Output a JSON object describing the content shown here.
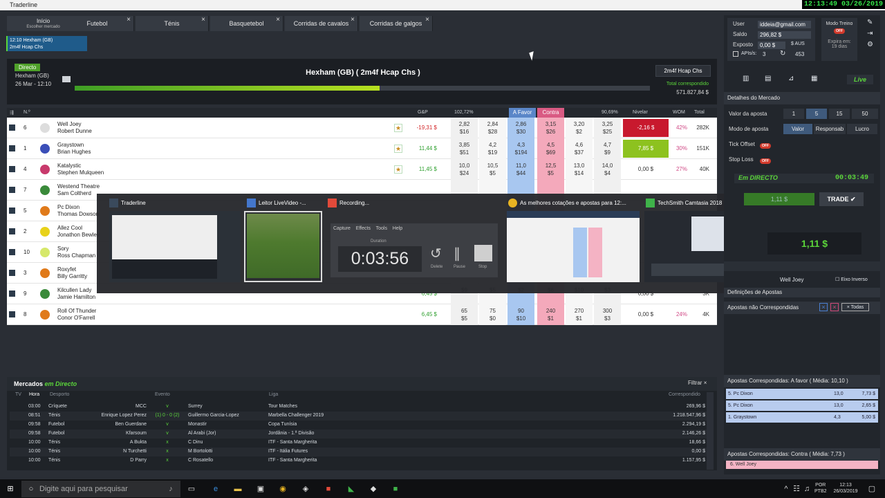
{
  "window": {
    "title": "Traderline",
    "clock": "12:13:49 03/26/2019"
  },
  "tabs": [
    {
      "label": "Início",
      "sub": "Escolher mercado"
    },
    {
      "label": "Futebol"
    },
    {
      "label": "Ténis"
    },
    {
      "label": "Basquetebol"
    },
    {
      "label": "Corridas de cavalos"
    },
    {
      "label": "Corridas de galgos"
    }
  ],
  "close_glyph": "×",
  "race_tab": {
    "line1": "12:10 Hexham (GB)",
    "line2": "2m4f Hcap Chs"
  },
  "race": {
    "badge": "Directo",
    "venue": "Hexham (GB)",
    "datetime": "26 Mar - 12:10",
    "title": "Hexham (GB) ( 2m4f Hcap Chs )",
    "market_button": "2m4f Hcap Chs",
    "matched_label": "Total correspondido",
    "matched_value": "571.827,84 $",
    "progress": 0.53
  },
  "grid": {
    "headers": {
      "n": "N.º",
      "gp": "G&P",
      "back_pct": "102,72%",
      "back": "A Favor",
      "lay": "Contra",
      "lay_pct": "90,69%",
      "nivelar": "Nivelar",
      "wom": "WOM",
      "total": "Total"
    },
    "runners": [
      {
        "num": "6",
        "horse": "Well Joey",
        "jockey": "Robert Dunne",
        "gp": "-19,31 $",
        "gp_color": "#d3282a",
        "back": [
          [
            "2,82",
            "$16"
          ],
          [
            "2,84",
            "$28"
          ],
          [
            "2,86",
            "$30"
          ]
        ],
        "lay": [
          [
            "3,15",
            "$26"
          ],
          [
            "3,20",
            "$2"
          ],
          [
            "3,25",
            "$25"
          ]
        ],
        "nivelar": "-2,16 $",
        "niv_bg": "#c8192e",
        "wom": "42%",
        "total": "282K",
        "silk": "#ddd"
      },
      {
        "num": "1",
        "horse": "Graystown",
        "jockey": "Brian Hughes",
        "gp": "11,44 $",
        "gp_color": "#2fa02f",
        "back": [
          [
            "3,85",
            "$51"
          ],
          [
            "4,2",
            "$19"
          ],
          [
            "4,3",
            "$194"
          ]
        ],
        "lay": [
          [
            "4,5",
            "$69"
          ],
          [
            "4,6",
            "$37"
          ],
          [
            "4,7",
            "$9"
          ]
        ],
        "nivelar": "7,85 $",
        "niv_bg": "#8dc21f",
        "wom": "30%",
        "total": "151K",
        "silk": "#3b4fb8"
      },
      {
        "num": "4",
        "horse": "Katalystic",
        "jockey": "Stephen Mulqueen",
        "gp": "11,45 $",
        "gp_color": "#2fa02f",
        "back": [
          [
            "10,0",
            "$24"
          ],
          [
            "10,5",
            "$5"
          ],
          [
            "11,0",
            "$44"
          ]
        ],
        "lay": [
          [
            "12,5",
            "$5"
          ],
          [
            "13,0",
            "$14"
          ],
          [
            "14,0",
            "$4"
          ]
        ],
        "nivelar": "0,00 $",
        "niv_bg": "",
        "wom": "27%",
        "total": "40K",
        "silk": "#c83a6c"
      },
      {
        "num": "7",
        "horse": "Westend Theatre",
        "jockey": "Sam Coltherd",
        "gp": "",
        "gp_color": "#2fa02f",
        "back": [
          [
            "",
            ""
          ],
          [
            "",
            ""
          ],
          [
            "",
            ""
          ]
        ],
        "lay": [
          [
            "",
            ""
          ],
          [
            "",
            ""
          ],
          [
            "",
            ""
          ]
        ],
        "nivelar": "",
        "niv_bg": "",
        "wom": "",
        "total": "",
        "silk": "#3a8a3a"
      },
      {
        "num": "5",
        "horse": "Pc Dixon",
        "jockey": "Thomas Dowson",
        "gp": "",
        "gp_color": "#2fa02f",
        "back": [
          [
            "",
            ""
          ],
          [
            "",
            ""
          ],
          [
            "",
            ""
          ]
        ],
        "lay": [
          [
            "",
            ""
          ],
          [
            "",
            ""
          ],
          [
            "",
            ""
          ]
        ],
        "nivelar": "",
        "niv_bg": "",
        "wom": "",
        "total": "",
        "silk": "#e07a1a"
      },
      {
        "num": "2",
        "horse": "Allez Cool",
        "jockey": "Jonathon Bewley",
        "gp": "",
        "gp_color": "#2fa02f",
        "back": [
          [
            "",
            ""
          ],
          [
            "",
            ""
          ],
          [
            "",
            ""
          ]
        ],
        "lay": [
          [
            "",
            ""
          ],
          [
            "",
            ""
          ],
          [
            "",
            ""
          ]
        ],
        "nivelar": "",
        "niv_bg": "",
        "wom": "",
        "total": "",
        "silk": "#e8d21a"
      },
      {
        "num": "10",
        "horse": "Sory",
        "jockey": "Ross Chapman",
        "gp": "",
        "gp_color": "#2fa02f",
        "back": [
          [
            "",
            ""
          ],
          [
            "",
            ""
          ],
          [
            "",
            ""
          ]
        ],
        "lay": [
          [
            "",
            ""
          ],
          [
            "",
            ""
          ],
          [
            "",
            ""
          ]
        ],
        "nivelar": "",
        "niv_bg": "",
        "wom": "",
        "total": "",
        "silk": "#d6e86a"
      },
      {
        "num": "3",
        "horse": "Roxyfet",
        "jockey": "Billy Garritty",
        "gp": "",
        "gp_color": "#2fa02f",
        "back": [
          [
            "",
            ""
          ],
          [
            "",
            ""
          ],
          [
            "",
            ""
          ]
        ],
        "lay": [
          [
            "",
            ""
          ],
          [
            "",
            ""
          ],
          [
            "",
            ""
          ]
        ],
        "nivelar": "",
        "niv_bg": "",
        "wom": "",
        "total": "",
        "silk": "#e07a1a"
      },
      {
        "num": "9",
        "horse": "Kilcullen Lady",
        "jockey": "Jamie Hamilton",
        "gp": "6,45 $",
        "gp_color": "#2fa02f",
        "back": [
          [
            "",
            "$9"
          ],
          [
            "",
            "$5"
          ],
          [
            "",
            "$2"
          ]
        ],
        "lay": [
          [
            "",
            "$6"
          ],
          [
            "",
            "$10"
          ],
          [
            "",
            "$3"
          ]
        ],
        "nivelar": "0,00 $",
        "niv_bg": "",
        "wom": "",
        "total": "3K",
        "silk": "#3a8a3a"
      },
      {
        "num": "8",
        "horse": "Roll Of Thunder",
        "jockey": "Conor O'Farrell",
        "gp": "6,45 $",
        "gp_color": "#2fa02f",
        "back": [
          [
            "65",
            "$5"
          ],
          [
            "75",
            "$0"
          ],
          [
            "90",
            "$10"
          ]
        ],
        "lay": [
          [
            "240",
            "$1"
          ],
          [
            "270",
            "$1"
          ],
          [
            "300",
            "$3"
          ]
        ],
        "nivelar": "0,00 $",
        "niv_bg": "",
        "wom": "24%",
        "total": "4K",
        "silk": "#e07a1a"
      }
    ]
  },
  "switcher": {
    "items": [
      "Traderline",
      "Leitor LiveVideo -...",
      "Recording...",
      "As melhores cotações e apostas para 12:...",
      "TechSmith Camtasia 2018"
    ],
    "recorder": {
      "menu": [
        "Capture",
        "Effects",
        "Tools",
        "Help"
      ],
      "duration_label": "Duration",
      "time": "0:03:56",
      "buttons": [
        "Delete",
        "Pause",
        "Stop"
      ]
    }
  },
  "markets": {
    "title": "Mercados",
    "title_live": "em Directo",
    "filter": "Filtrar",
    "cols": [
      "TV",
      "Hora",
      "Desporto",
      "Evento",
      "Liga",
      "Correspondido"
    ],
    "rows": [
      {
        "hora": "03:00",
        "desporto": "Críquete",
        "home": "MCC",
        "score": "v",
        "away": "Surrey",
        "liga": "Tour Matches",
        "corr": "269,96 $"
      },
      {
        "hora": "08:51",
        "desporto": "Ténis",
        "home": "Enrique Lopez Perez",
        "score": "(1) 0 - 0 (2)",
        "away": "Guillermo Garcia-Lopez",
        "liga": "Marbella Challenger 2019",
        "corr": "1.218.547,96 $"
      },
      {
        "hora": "09:58",
        "desporto": "Futebol",
        "home": "Ben Guerdane",
        "score": "v",
        "away": "Monastir",
        "liga": "Copa Tunísia",
        "corr": "2.294,19 $"
      },
      {
        "hora": "09:58",
        "desporto": "Futebol",
        "home": "Kfarsoum",
        "score": "v",
        "away": "Al Arabi (Jor)",
        "liga": "Jordânia - 1.ª Divisão",
        "corr": "2.146,26 $"
      },
      {
        "hora": "10:00",
        "desporto": "Ténis",
        "home": "A Bukta",
        "score": "x",
        "away": "C Dinu",
        "liga": "ITF - Santa Margherita",
        "corr": "18,66 $"
      },
      {
        "hora": "10:00",
        "desporto": "Ténis",
        "home": "N Turchetti",
        "score": "x",
        "away": "M Bortolotti",
        "liga": "ITF - Itália Futures",
        "corr": "0,00 $"
      },
      {
        "hora": "10:00",
        "desporto": "Ténis",
        "home": "D Parry",
        "score": "x",
        "away": "C Rosatello",
        "liga": "ITF - Santa Margherita",
        "corr": "1.157,95 $"
      }
    ]
  },
  "account": {
    "user_label": "User",
    "user": "iddeia@gmail.com",
    "saldo_label": "Saldo",
    "saldo": "296,82 $",
    "exposto_label": "Exposto",
    "exposto": "0,00 $",
    "currency": "AUS",
    "apis_label": "APIs/s:",
    "apis": "3",
    "count": "453",
    "treino": "Modo Treino",
    "off": "OFF",
    "expira": "Expira em:",
    "dias": "19 dias"
  },
  "panel": {
    "live": "Live",
    "detalhes": "Detalhes do Mercado",
    "valor_label": "Valor da aposta",
    "stakes": [
      "1",
      "5",
      "15",
      "50"
    ],
    "modo_label": "Modo de aposta",
    "modes": [
      "Valor",
      "Responsab",
      "Lucro"
    ],
    "tick_label": "Tick Offset",
    "stop_label": "Stop Loss",
    "em_directo": "Em DIRECTO",
    "timer": "00:03:49",
    "price_small": "1,11 $",
    "trade": "TRADE",
    "price": "1,11 $",
    "selected_runner": "Well Joey",
    "eixo": "Eixo Inverso",
    "definicoes": "Definições de Apostas",
    "nao_corr": "Apostas não Correspondidas",
    "todas": "Todas",
    "corr_favor": "Apostas Correspondidas: A favor ( Média: 10,10 )",
    "favor_rows": [
      {
        "n": "5. Pc Dixon",
        "odd": "13,0",
        "val": "7,73 $"
      },
      {
        "n": "5. Pc Dixon",
        "odd": "13,0",
        "val": "2,65 $"
      },
      {
        "n": "1. Graystown",
        "odd": "4,3",
        "val": "5,00 $"
      }
    ],
    "corr_contra": "Apostas Correspondidas: Contra ( Média: 7,73 )",
    "contra_row": "6. Well Joey"
  },
  "taskbar": {
    "search": "Digite aqui para pesquisar",
    "lang": "POR",
    "layout": "PTB2",
    "time": "12:13",
    "date": "26/03/2019"
  }
}
